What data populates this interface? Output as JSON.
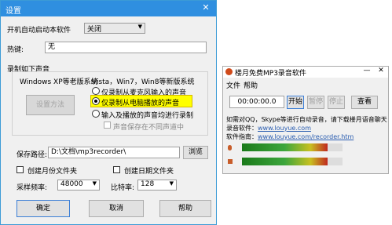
{
  "settings": {
    "title": "设置",
    "autostart_label": "开机自动启动本软件",
    "autostart_value": "关闭",
    "hotkey_label": "热键:",
    "hotkey_value": "无",
    "record_group_label": "录制如下声音",
    "xp_header": "Windows XP等老版系统",
    "xp_button": "设置方法",
    "vista_header": "Vista，Win7，Win8等新版系统",
    "radio_mic": "仅录制从麦克风输入的声音",
    "radio_pc": "仅录制从电脑播放的声音",
    "radio_both": "输入及播放的声音均进行录制",
    "checkbox_separate": "声音保存在不同声道中",
    "save_path_label": "保存路径:",
    "save_path_value": "D:\\文档\\mp3recorder\\",
    "browse_button": "浏览",
    "month_folder_label": "创建月份文件夹",
    "date_folder_label": "创建日期文件夹",
    "sample_rate_label": "采样频率:",
    "sample_rate_value": "48000",
    "bitrate_label": "比特率:",
    "bitrate_value": "128",
    "ok_button": "确定",
    "cancel_button": "取消",
    "help_button": "帮助"
  },
  "recorder": {
    "title": "楼月免费MP3录音软件",
    "menu_file": "文件",
    "menu_help": "帮助",
    "time": "00:00:00.0",
    "start_button": "开始",
    "pause_button": "暂停",
    "stop_button": "停止",
    "view_button": "查看",
    "info_line1": "如需对QQ，Skype等进行自动录音，请下载楼月语音聊天",
    "info_line2_prefix": "录音软件：",
    "info_line2_link": "www.louyue.com",
    "info_line3_prefix": "软件指南：",
    "info_line3_link": "www.louyue.com/recorder.htm",
    "mic_level": 0.85,
    "speaker_level": 0.85
  },
  "colors": {
    "titlebar": "#2f8fe0",
    "highlight": "#ffff00",
    "link": "#2a5db0"
  }
}
